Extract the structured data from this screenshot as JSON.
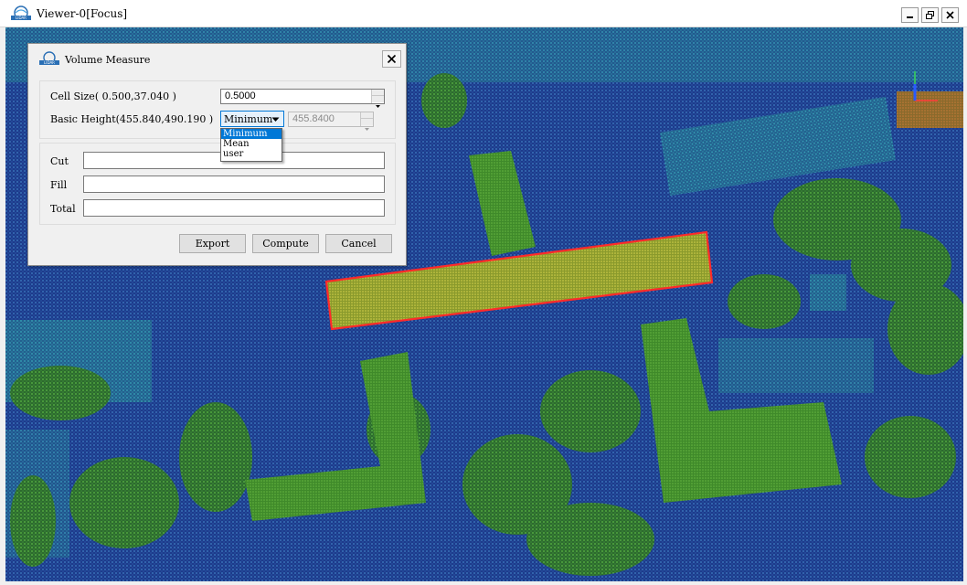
{
  "window": {
    "title": "Viewer-0[Focus]",
    "logo_icon": "lidar-logo-icon",
    "controls": [
      "minimize-icon",
      "restore-icon",
      "close-icon"
    ]
  },
  "dialog": {
    "title": "Volume Measure",
    "cell_size": {
      "label": "Cell Size( 0.500,37.040 )",
      "value": "0.5000"
    },
    "basic_height": {
      "label": "Basic Height(455.840,490.190 )",
      "method_selected": "Minimum",
      "options": [
        "Minimum",
        "Mean",
        "user"
      ],
      "value": "455.8400"
    },
    "results": {
      "cut_label": "Cut",
      "cut_value": "",
      "fill_label": "Fill",
      "fill_value": "",
      "total_label": "Total",
      "total_value": ""
    },
    "buttons": {
      "export": "Export",
      "compute": "Compute",
      "cancel": "Cancel"
    }
  },
  "colors": {
    "selection_outline": "#ff2a2a",
    "highlighted_points": "#c9c84a",
    "ground_blue": "#1f3f92",
    "vegetation_green": "#3e8f3a",
    "building_green": "#4a9a2e",
    "accent": "#0078d7"
  }
}
